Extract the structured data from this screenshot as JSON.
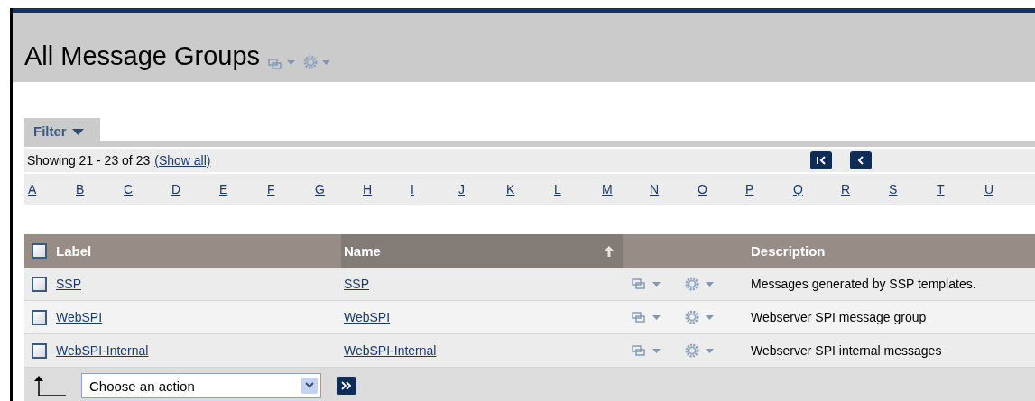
{
  "title": "All Message Groups",
  "filter": {
    "label": "Filter"
  },
  "paging": {
    "showing": "Showing 21 - 23 of 23",
    "show_all": "(Show all)"
  },
  "letters": [
    "A",
    "B",
    "C",
    "D",
    "E",
    "F",
    "G",
    "H",
    "I",
    "J",
    "K",
    "L",
    "M",
    "N",
    "O",
    "P",
    "Q",
    "R",
    "S",
    "T",
    "U"
  ],
  "table": {
    "select_all": {
      "checked": false
    },
    "columns": [
      {
        "label": "Label",
        "sorted": false
      },
      {
        "label": "Name",
        "sorted": true
      },
      {
        "label": "Description",
        "sorted": false
      }
    ],
    "rows": [
      {
        "checked": false,
        "label": "SSP",
        "name": "SSP",
        "description": "Messages generated by SSP templates."
      },
      {
        "checked": false,
        "label": "WebSPI",
        "name": "WebSPI",
        "description": "Webserver SPI message group"
      },
      {
        "checked": false,
        "label": "WebSPI-Internal",
        "name": "WebSPI-Internal",
        "description": "Webserver SPI internal messages"
      }
    ]
  },
  "action": {
    "value": "Choose an action"
  }
}
